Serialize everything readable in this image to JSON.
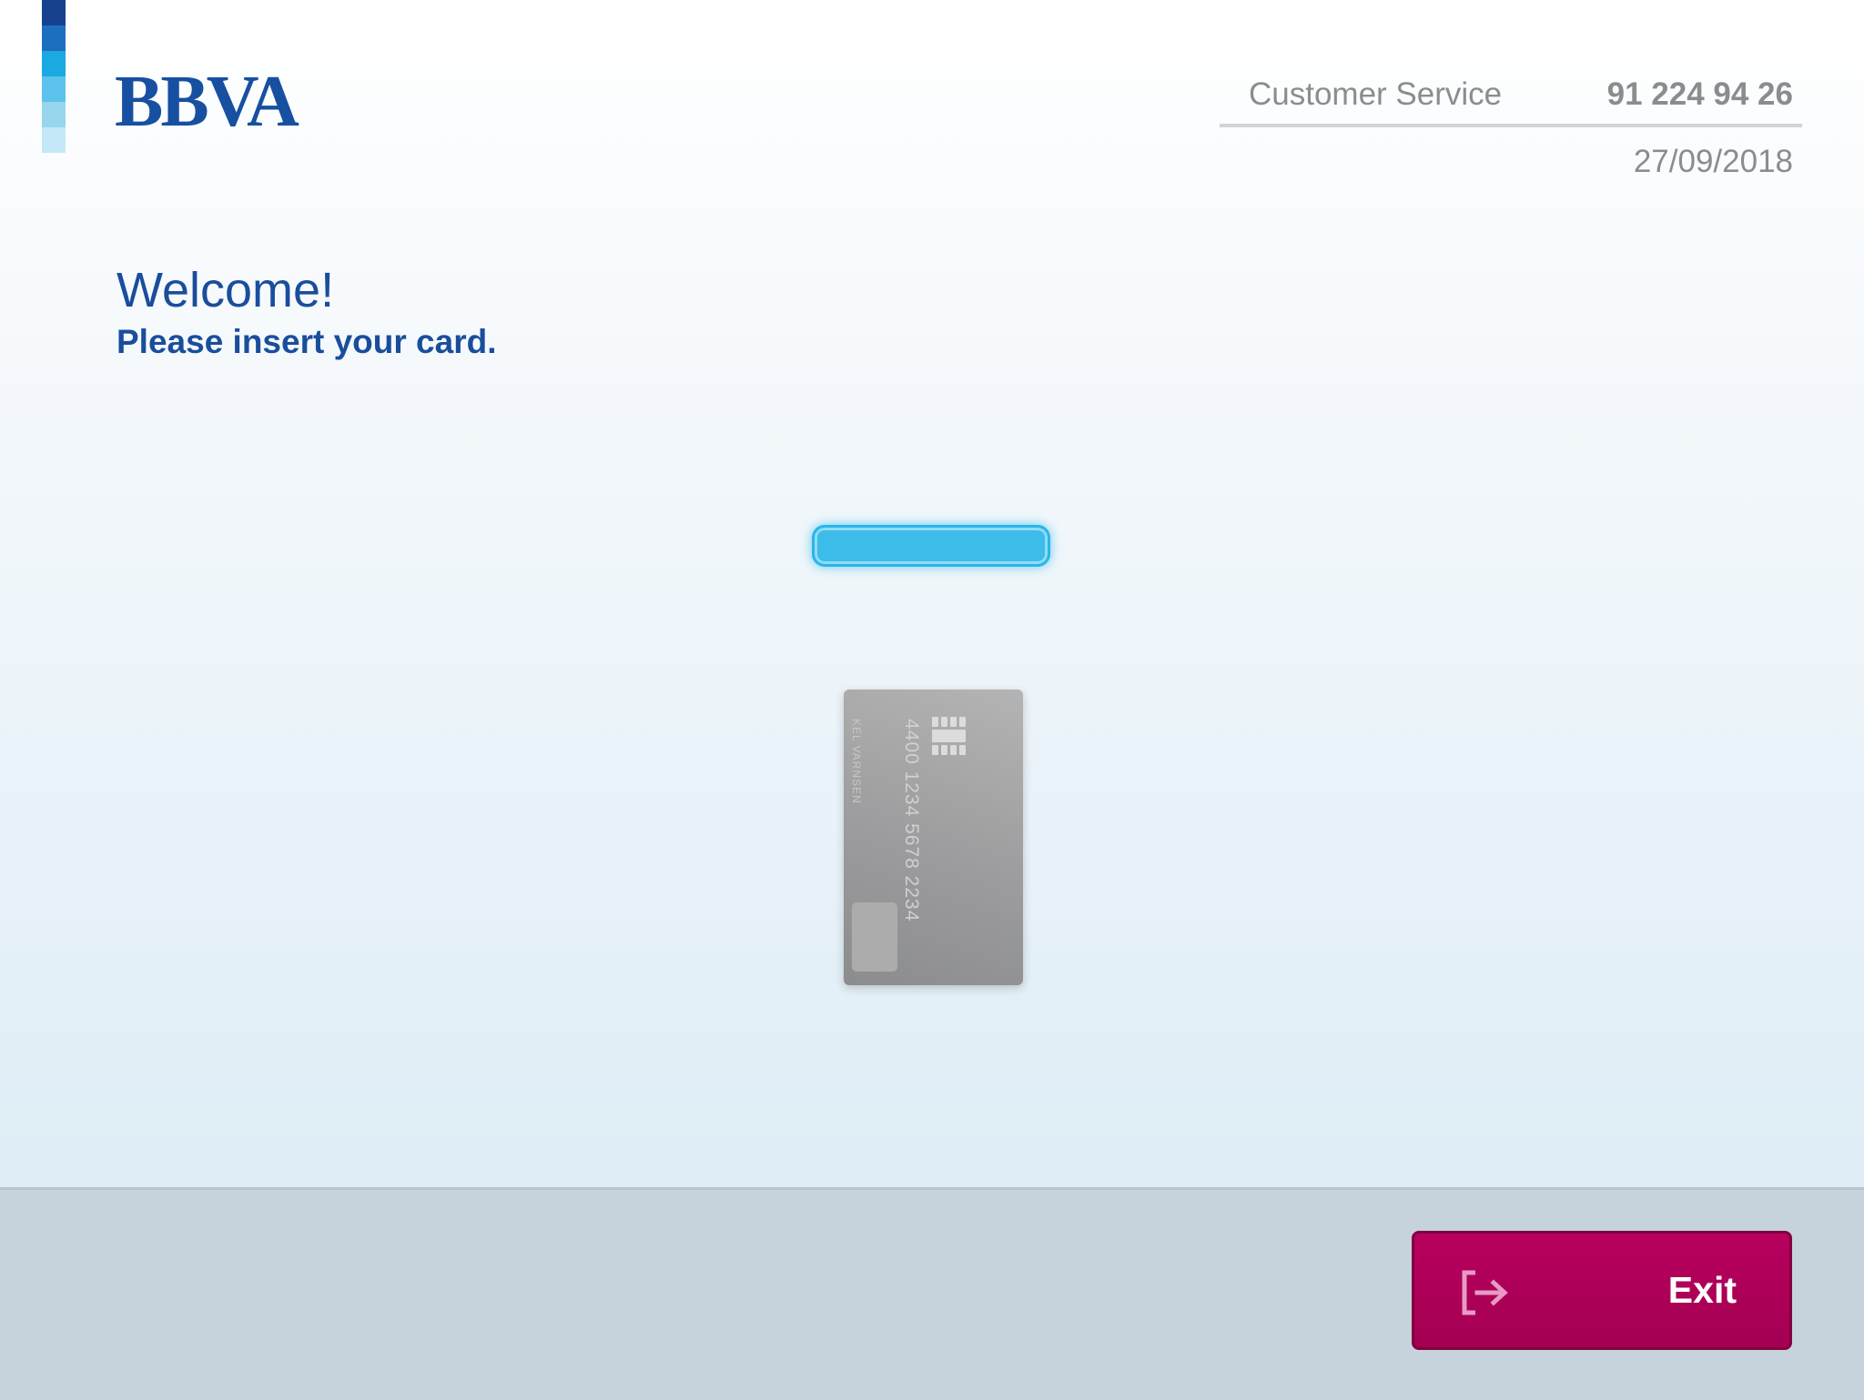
{
  "brand": {
    "name": "BBVA",
    "primary_color": "#1750a0",
    "strip_colors": [
      "#15418f",
      "#1c6fbf",
      "#1aa9e0",
      "#5ec3ec",
      "#98d6ee",
      "#c4e8f8"
    ]
  },
  "header": {
    "service_label": "Customer Service",
    "service_phone": "91 224 94 26",
    "date": "27/09/2018"
  },
  "main": {
    "welcome": "Welcome!",
    "instruction": "Please insert your card.",
    "card_slot_color": "#3dbbe9",
    "card": {
      "number": "4400 1234 5678 2234",
      "holder": "KEL VARNSEN",
      "chip_icon": "chip-icon"
    }
  },
  "footer": {
    "exit_label": "Exit",
    "exit_icon": "exit-icon",
    "exit_color": "#b0005a"
  }
}
